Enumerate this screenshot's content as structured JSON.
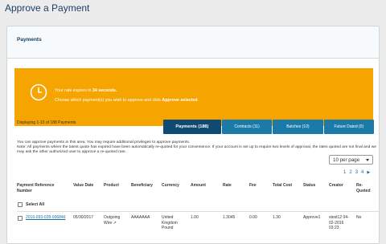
{
  "page_title": "Approve a Payment",
  "panel_title": "Payments",
  "alert": {
    "line1_pre": "Your rate expires in ",
    "line1_bold": "34 seconds.",
    "line2_pre": "Choose which payment(s) you wish to approve and click ",
    "line2_bold": "Approve selected",
    "line2_post": "."
  },
  "displaying": "Displaying 1-10 of 188 Payments",
  "tabs": [
    {
      "label": "Payments (188)"
    },
    {
      "label": "Contracts (11)"
    },
    {
      "label": "Batches (10)"
    },
    {
      "label": "Future Dated (0)"
    }
  ],
  "info_line1": "You can approve payments in this area. You may require additional privileges to approve payments.",
  "info_line2": "Note: All payments where the latest quote has expired have been automatically re-quoted for your convenience. If your account is set up to require two levels of approval, the rates quoted are not final and we may ask the other authorized user to approve a re-quoted rate.",
  "per_page": "10 per page",
  "pager": {
    "pages": [
      "1",
      "2",
      "3",
      "4"
    ],
    "next": "▶"
  },
  "columns": [
    "Payment Reference Number",
    "Value Date",
    "Product",
    "Beneficiary",
    "Currency",
    "Amount",
    "Rate",
    "Fee",
    "Total Cost",
    "Status",
    "Creator",
    "Re-Quoted"
  ],
  "select_all": "Select All",
  "rows": [
    {
      "ref": "2016-093-028-006846",
      "value_date": "05/30/2017",
      "product": "Outgoing Wire",
      "beneficiary": "AAAAAAA",
      "currency": "United Kingdom Pound",
      "amount": "1.00",
      "rate": "1.3045",
      "fee": "0.00",
      "total": "1.30",
      "status": "Approve1",
      "creator": "stest12 04-02-2016 03:23",
      "requoted": "No"
    }
  ],
  "colors": {
    "accent": "#f6a400",
    "tab": "#1b7aa8",
    "tab_active": "#0f4a72",
    "link": "#1b6fa8"
  }
}
